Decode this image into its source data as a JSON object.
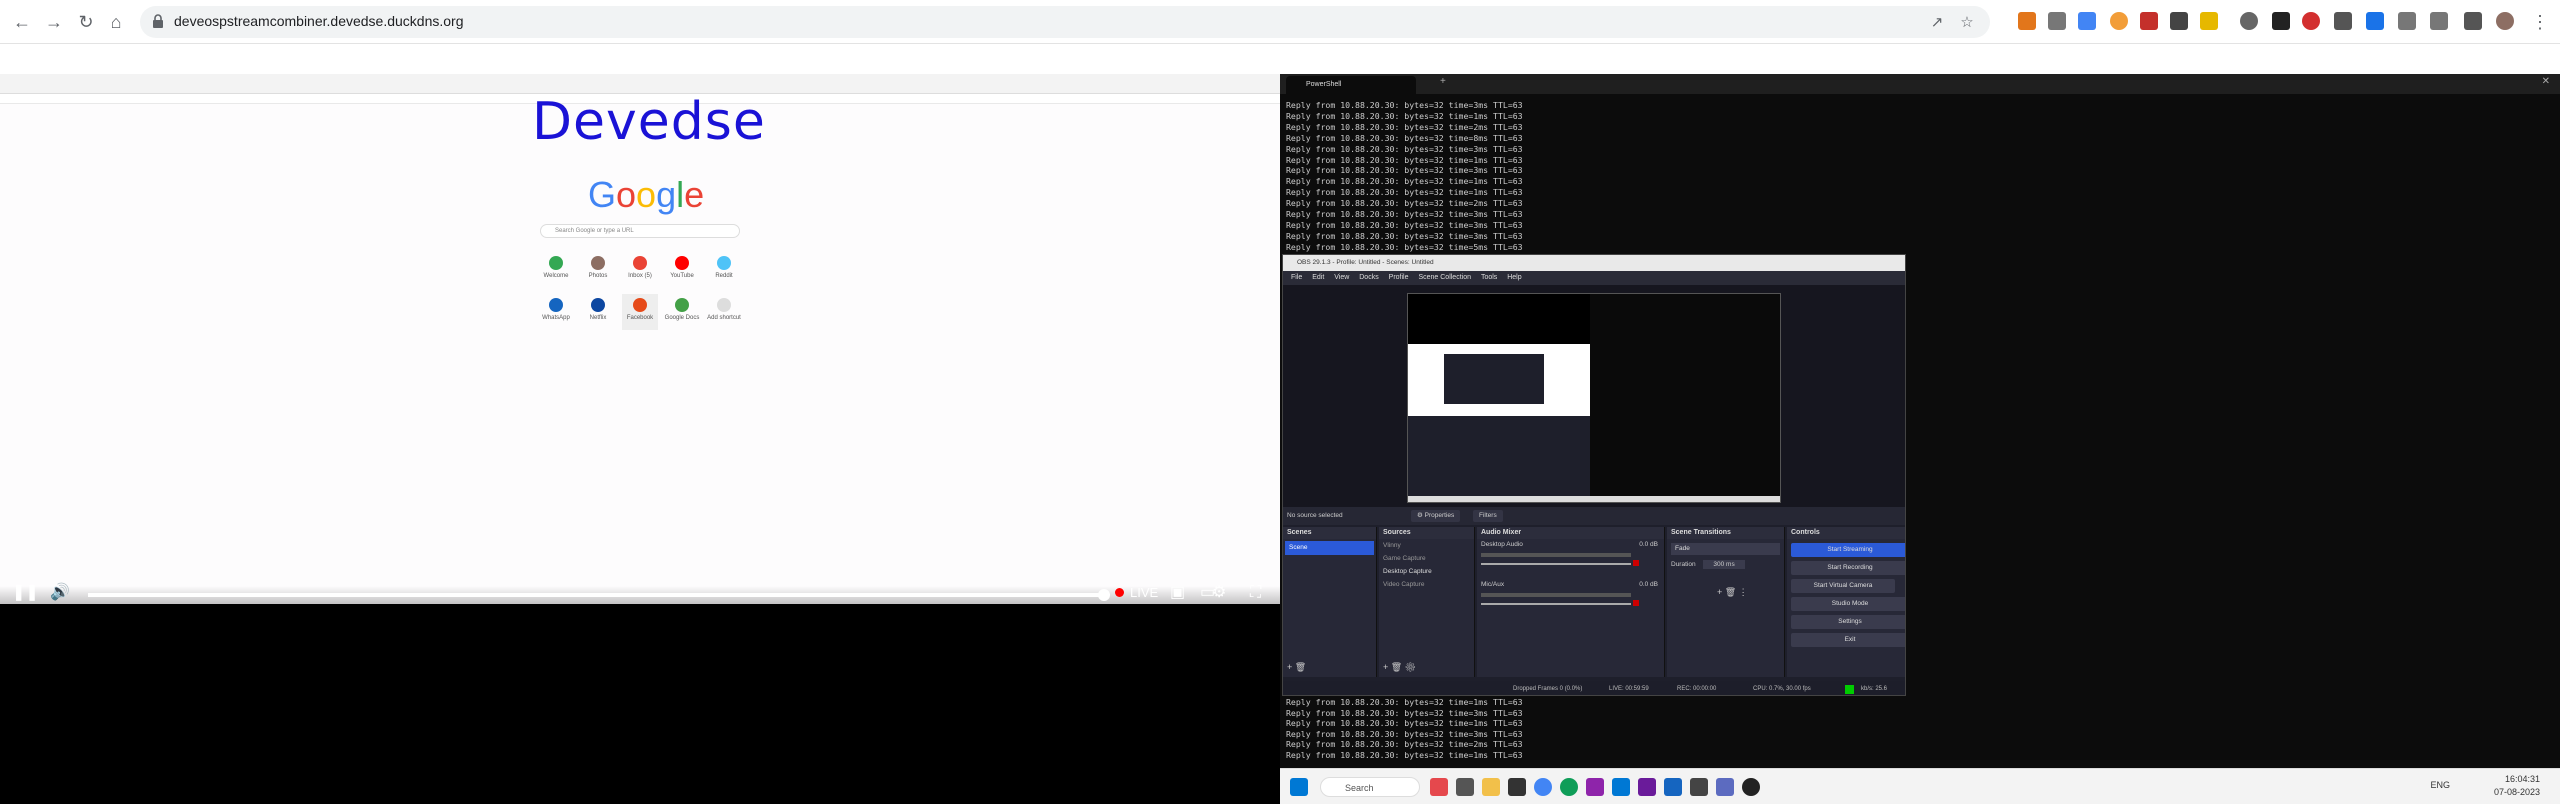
{
  "browser": {
    "url": "deveospstreamcombiner.devedse.duckdns.org"
  },
  "stream": {
    "heading": "Devedse",
    "google_logo": "Google",
    "search_placeholder": "Search Google or type a URL",
    "shortcuts_row1": [
      "Welcome",
      "Photos",
      "Inbox (5)",
      "YouTube",
      "Reddit"
    ],
    "shortcuts_row2": [
      "WhatsApp",
      "Netflix",
      "Facebook",
      "Google Docs",
      "Add shortcut"
    ],
    "live_label": "LIVE"
  },
  "powershell": {
    "tab_title": "PowerShell",
    "lines_top": [
      "Reply from 10.88.20.30: bytes=32 time=3ms TTL=63",
      "Reply from 10.88.20.30: bytes=32 time=1ms TTL=63",
      "Reply from 10.88.20.30: bytes=32 time=2ms TTL=63",
      "Reply from 10.88.20.30: bytes=32 time=8ms TTL=63",
      "Reply from 10.88.20.30: bytes=32 time=3ms TTL=63",
      "Reply from 10.88.20.30: bytes=32 time=1ms TTL=63",
      "Reply from 10.88.20.30: bytes=32 time=3ms TTL=63",
      "Reply from 10.88.20.30: bytes=32 time=1ms TTL=63",
      "Reply from 10.88.20.30: bytes=32 time=1ms TTL=63",
      "Reply from 10.88.20.30: bytes=32 time=2ms TTL=63",
      "Reply from 10.88.20.30: bytes=32 time=3ms TTL=63",
      "Reply from 10.88.20.30: bytes=32 time=3ms TTL=63",
      "Reply from 10.88.20.30: bytes=32 time=3ms TTL=63",
      "Reply from 10.88.20.30: bytes=32 time=5ms TTL=63"
    ],
    "lines_bottom": [
      "Reply from 10.88.20.30: bytes=32 time=1ms TTL=63",
      "Reply from 10.88.20.30: bytes=32 time=3ms TTL=63",
      "Reply from 10.88.20.30: bytes=32 time=1ms TTL=63",
      "Reply from 10.88.20.30: bytes=32 time=3ms TTL=63",
      "Reply from 10.88.20.30: bytes=32 time=2ms TTL=63",
      "Reply from 10.88.20.30: bytes=32 time=1ms TTL=63"
    ]
  },
  "obs": {
    "title": "OBS 29.1.3 - Profile: Untitled - Scenes: Untitled",
    "menu": [
      "File",
      "Edit",
      "View",
      "Docks",
      "Profile",
      "Scene Collection",
      "Tools",
      "Help"
    ],
    "no_source": "No source selected",
    "properties": "Properties",
    "filters": "Filters",
    "docks": {
      "scenes": "Scenes",
      "sources": "Sources",
      "audio_mixer": "Audio Mixer",
      "transitions": "Scene Transitions",
      "controls": "Controls"
    },
    "scene_items": [
      "Scene"
    ],
    "source_items": [
      "Vlinny",
      "Game Capture",
      "Desktop Capture",
      "Video Capture"
    ],
    "audio": {
      "desktop_label": "Desktop Audio",
      "desktop_db": "0.0 dB",
      "mic_label": "Mic/Aux",
      "mic_db": "0.0 dB"
    },
    "transition": {
      "type": "Fade",
      "duration_label": "Duration",
      "duration": "300 ms"
    },
    "controls": [
      "Start Streaming",
      "Start Recording",
      "Start Virtual Camera",
      "Studio Mode",
      "Settings",
      "Exit"
    ],
    "status": {
      "dropped": "Dropped Frames 0 (0.0%)",
      "live": "LIVE: 00:59:59",
      "rec": "REC: 00:00:00",
      "cpu": "CPU: 0.7%, 30.00 fps",
      "kbps": "kb/s: 25.6"
    }
  },
  "taskbar": {
    "search": "Search",
    "lang": "ENG",
    "time": "16:04:31",
    "date": "07-08-2023"
  },
  "colors": {
    "obs_active_button": "#2b5ad8",
    "live_dot": "#ff0000",
    "devedse_blue": "#1a12d6"
  }
}
